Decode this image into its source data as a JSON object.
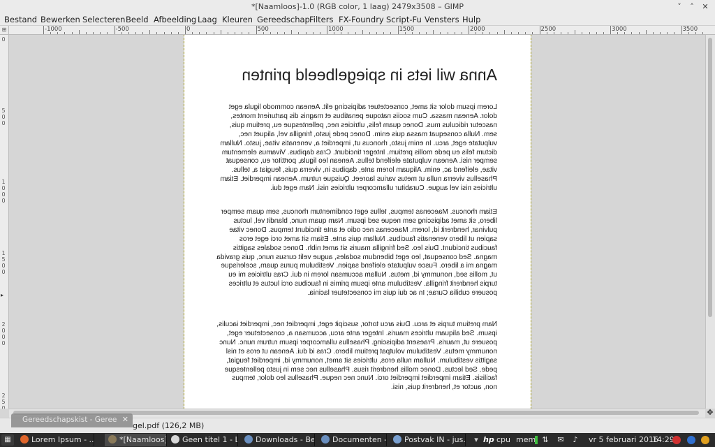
{
  "window": {
    "title": "*[Naamloos]-1.0 (RGB color, 1 laag) 2479x3508 – GIMP",
    "controls": [
      "˅",
      "˄",
      "✕"
    ]
  },
  "menu": [
    "Bestand",
    "Bewerken",
    "Selecteren",
    "Beeld",
    "Afbeelding",
    "Laag",
    "Kleuren",
    "Gereedschap",
    "Filters",
    "FX-Foundry",
    "Script-Fu",
    "Vensters",
    "Hulp"
  ],
  "ruler": {
    "h_labels": [
      "-1000",
      "-500",
      "0",
      "500",
      "1000",
      "1500",
      "2000",
      "2500",
      "3000",
      "3500"
    ],
    "v_labels": [
      "0",
      "5 0 0",
      "1 0 0 0",
      "1 5 0 0",
      "2 0 0 0",
      "2 5 0 0"
    ]
  },
  "document": {
    "heading": "Anna wil iets in spiegelbeeld printen",
    "paragraphs": [
      "Lorem ipsum dolor sit amet, consectetuer adipiscing elit. Aenean commodo ligula eget dolor. Aenean massa. Cum sociis natoque penatibus et magnis dis parturient montes, nascetur ridiculus mus. Donec quam felis, ultricies nec, pellentesque eu, pretium quis, sem. Nulla consequat massa quis enim. Donec pede justo, fringilla vel, aliquet nec, vulputate eget, arcu. In enim justo, rhoncus ut, imperdiet a, venenatis vitae, justo. Nullam dictum felis eu pede mollis pretium. Integer tincidunt. Cras dapibus. Vivamus elementum semper nisi. Aenean vulputate eleifend tellus. Aenean leo ligula, porttitor eu, consequat vitae, eleifend ac, enim. Aliquam lorem ante, dapibus in, viverra quis, feugiat a, tellus. Phasellus viverra nulla ut metus varius laoreet. Quisque rutrum. Aenean imperdiet. Etiam ultricies nisi vel augue. Curabitur ullamcorper ultricies nisi. Nam eget dui.",
      "Etiam rhoncus. Maecenas tempus, tellus eget condimentum rhoncus, sem quam semper libero, sit amet adipiscing sem neque sed ipsum. Nam quam nunc, blandit vel, luctus pulvinar, hendrerit id, lorem. Maecenas nec odio et ante tincidunt tempus. Donec vitae sapien ut libero venenatis faucibus. Nullam quis ante. Etiam sit amet orci eget eros faucibus tincidunt. Duis leo. Sed fringilla mauris sit amet nibh. Donec sodales sagittis magna. Sed consequat, leo eget bibendum sodales, augue velit cursus nunc, quis gravida magna mi a libero. Fusce vulputate eleifend sapien. Vestibulum purus quam, scelerisque ut, mollis sed, nonummy id, metus. Nullam accumsan lorem in dui. Cras ultricies mi eu turpis hendrerit fringilla. Vestibulum ante ipsum primis in faucibus orci luctus et ultrices posuere cubilia Curae; In ac dui quis mi consectetuer lacinia.",
      "Nam pretium turpis et arcu. Duis arcu tortor, suscipit eget, imperdiet nec, imperdiet iaculis, ipsum. Sed aliquam ultrices mauris. Integer ante arcu, accumsan a, consectetuer eget, posuere ut, mauris. Praesent adipiscing. Phasellus ullamcorper ipsum rutrum nunc. Nunc nonummy metus. Vestibulum volutpat pretium libero. Cras id dui. Aenean ut eros et nisl sagittis vestibulum. Nullam nulla eros, ultricies sit amet, nonummy id, imperdiet feugiat, pede. Sed lectus. Donec mollis hendrerit risus. Phasellus nec sem in justo pellentesque facilisis. Etiam imperdiet imperdiet orci. Nunc nec neque. Phasellus leo dolor, tempus non, auctor et, hendrerit quis, nisi."
    ]
  },
  "status": {
    "file": "gel.pdf (126,2 MB)"
  },
  "floating_window": {
    "title": "Gereedschapskist - Geree",
    "close": "✕"
  },
  "taskbar": {
    "tasks": [
      {
        "label": "Lorem Ipsum - ...",
        "color": "#e0662c",
        "active": false
      },
      {
        "label": "*[Naamloos]-1....",
        "color": "#8a7a5a",
        "active": true
      },
      {
        "label": "Geen titel 1 - Li...",
        "color": "#d8d8d8",
        "active": false
      },
      {
        "label": "Downloads - Be...",
        "color": "#6a8fbf",
        "active": false
      },
      {
        "label": "Documenten - ...",
        "color": "#6a8fbf",
        "active": false
      },
      {
        "label": "Postvak IN - jus...",
        "color": "#7aa0d0",
        "active": false
      }
    ],
    "tray": {
      "hp": "hp",
      "cpu": "cpu",
      "mem": "mem",
      "date": "vr 5 februari 2016",
      "time": "14:29"
    }
  }
}
